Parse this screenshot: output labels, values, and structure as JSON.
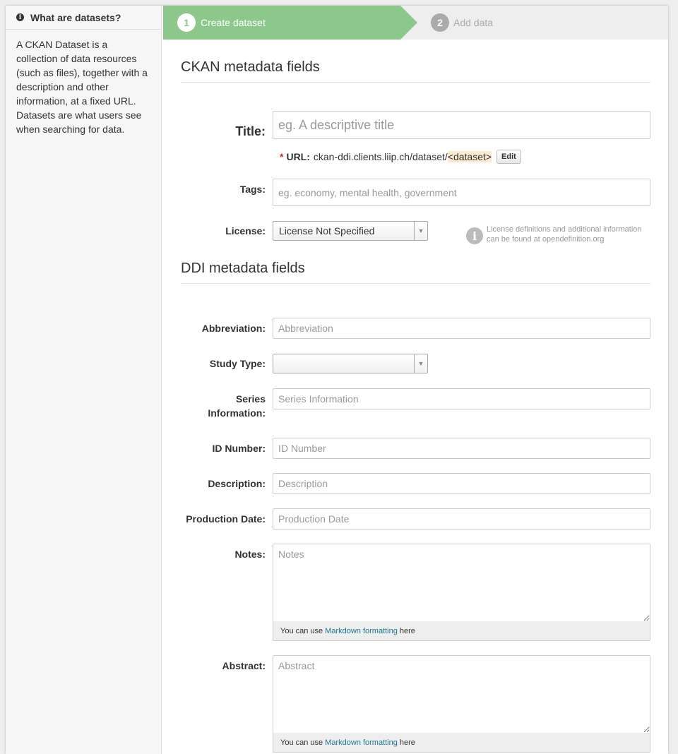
{
  "sidebar": {
    "heading": "What are datasets?",
    "body": "A CKAN Dataset is a collection of data resources (such as files), together with a description and other information, at a fixed URL. Datasets are what users see when searching for data."
  },
  "stages": [
    {
      "number": "1",
      "label": "Create dataset",
      "active": true
    },
    {
      "number": "2",
      "label": "Add data",
      "active": false
    }
  ],
  "ckan_section": {
    "title": "CKAN metadata fields",
    "title_field": {
      "label": "Title:",
      "placeholder": "eg. A descriptive title"
    },
    "url": {
      "required_mark": "*",
      "label": "URL:",
      "prefix": "ckan-ddi.clients.liip.ch/dataset/",
      "slug": "<dataset>",
      "edit_label": "Edit"
    },
    "tags": {
      "label": "Tags:",
      "placeholder": "eg. economy, mental health, government"
    },
    "license": {
      "label": "License:",
      "selected": "License Not Specified",
      "info_text": "License definitions and additional information can be found at",
      "info_link": "opendefinition.org"
    }
  },
  "ddi_section": {
    "title": "DDI metadata fields",
    "abbreviation": {
      "label": "Abbreviation:",
      "placeholder": "Abbreviation"
    },
    "study_type": {
      "label": "Study Type:",
      "selected": ""
    },
    "series_information": {
      "label_line1": "Series",
      "label_line2": "Information:",
      "placeholder": "Series Information"
    },
    "id_number": {
      "label": "ID Number:",
      "placeholder": "ID Number"
    },
    "description": {
      "label": "Description:",
      "placeholder": "Description"
    },
    "production_date": {
      "label": "Production Date:",
      "placeholder": "Production Date"
    },
    "notes": {
      "label": "Notes:",
      "placeholder": "Notes"
    },
    "abstract": {
      "label": "Abstract:",
      "placeholder": "Abstract"
    },
    "markdown_hint": {
      "before": "You can use",
      "link": "Markdown formatting",
      "after": "here"
    }
  },
  "colors": {
    "stage_active": "#8cc88c",
    "link": "#187794",
    "required": "#c6262e",
    "slug_highlight": "#faebd0"
  },
  "icons": {
    "sidebar": "info-icon",
    "license": "info-icon",
    "select": "chevron-down-icon"
  }
}
